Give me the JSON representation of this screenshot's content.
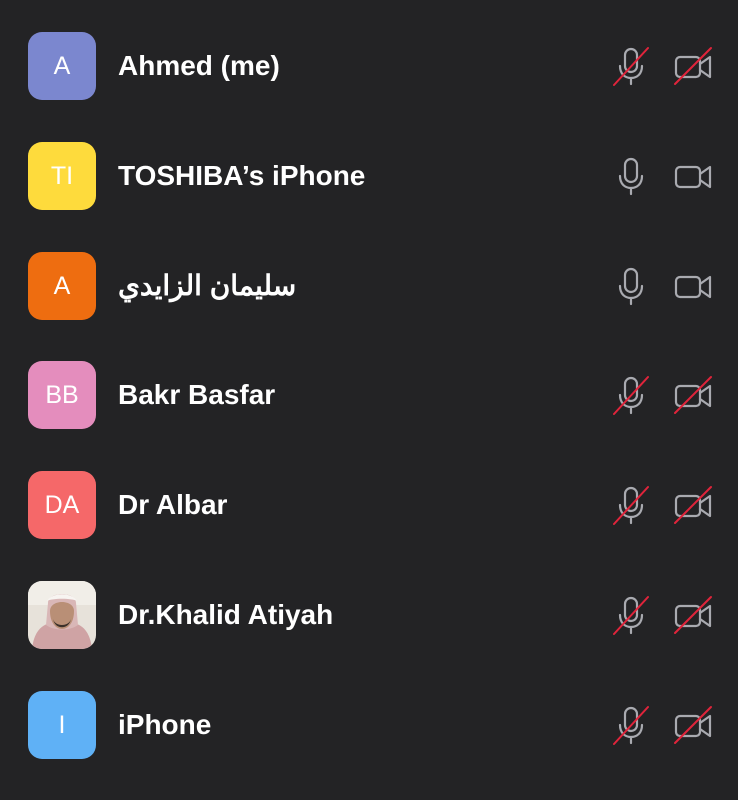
{
  "colors": {
    "background": "#232325",
    "text": "#ffffff",
    "icon": "#a9aab0",
    "muted_slash": "#e0243b"
  },
  "participants": [
    {
      "initials": "A",
      "name": "Ahmed (me)",
      "avatar_color": "#7b87cf",
      "mic_muted": true,
      "video_off": true,
      "photo": false
    },
    {
      "initials": "TI",
      "name": "TOSHIBA’s iPhone",
      "avatar_color": "#fedb3c",
      "mic_muted": false,
      "video_off": false,
      "photo": false
    },
    {
      "initials": "A",
      "name": "سليمان الزايدي",
      "avatar_color": "#ee6d10",
      "mic_muted": false,
      "video_off": false,
      "photo": false
    },
    {
      "initials": "BB",
      "name": "Bakr Basfar",
      "avatar_color": "#e48dbd",
      "mic_muted": true,
      "video_off": true,
      "photo": false
    },
    {
      "initials": "DA",
      "name": "Dr Albar",
      "avatar_color": "#f56869",
      "mic_muted": true,
      "video_off": true,
      "photo": false
    },
    {
      "initials": "",
      "name": "Dr.Khalid Atiyah",
      "avatar_color": "#d9d3cb",
      "mic_muted": true,
      "video_off": true,
      "photo": true
    },
    {
      "initials": "I",
      "name": "iPhone",
      "avatar_color": "#5fb1f6",
      "mic_muted": true,
      "video_off": true,
      "photo": false
    }
  ],
  "icons": {
    "mic": "microphone-icon",
    "camera": "video-camera-icon",
    "mic_muted": "microphone-muted-icon",
    "camera_off": "video-camera-off-icon"
  }
}
